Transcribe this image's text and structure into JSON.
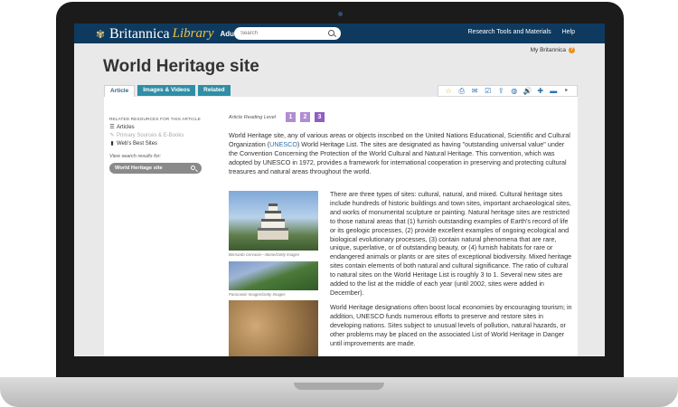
{
  "header": {
    "logo_text": "Britannica",
    "logo_library": "Library",
    "edition": "Adult",
    "search_placeholder": "Search",
    "nav": [
      "Research Tools and Materials",
      "Help"
    ],
    "my_britannica": "My Britannica"
  },
  "article": {
    "title": "World Heritage site",
    "tabs": [
      {
        "label": "Article",
        "active": true
      },
      {
        "label": "Images & Videos",
        "active": false
      },
      {
        "label": "Related",
        "active": false
      }
    ],
    "toolbar_icons": [
      "star-icon",
      "print-icon",
      "email-icon",
      "cite-icon",
      "share-icon",
      "globe-icon",
      "audio-icon",
      "zoom-in-icon",
      "zoom-out-icon",
      "next-icon"
    ],
    "reading_level_label": "Article Reading Level",
    "reading_levels": [
      "1",
      "2",
      "3"
    ],
    "current_level": "3",
    "intro_before": "World Heritage site,  any of various areas or objects inscribed on the United Nations Educational, Scientific and Cultural Organization (",
    "intro_link": "UNESCO",
    "intro_after": ") World Heritage List. The sites are designated as having \"outstanding universal value\" under the Convention Concerning the Protection of the World Cultural and Natural Heritage. This convention, which was adopted by UNESCO in 1972, provides a framework for international cooperation in preserving and protecting cultural treasures and natural areas throughout the world.",
    "paragraph_1": "There are three types of sites: cultural, natural, and mixed. Cultural heritage sites include hundreds of historic buildings and town sites, important archaeological sites, and works of monumental sculpture or painting. Natural heritage sites are restricted to those natural areas that (1) furnish outstanding examples of Earth's record of life or its geologic processes, (2) provide excellent examples of ongoing ecological and biological evolutionary processes, (3) contain natural phenomena that are rare, unique, superlative, or of outstanding beauty, or (4) furnish habitats for rare or endangered animals or plants or are sites of exceptional biodiversity. Mixed heritage sites contain elements of both natural and cultural significance. The ratio of cultural to natural sites on the World Heritage List is roughly 3 to 1. Several new sites are added to the list at the middle of each year (until 2002, sites were added in December).",
    "paragraph_2": "World Heritage designations often boost local economies by encouraging tourism; in addition, UNESCO funds numerous efforts to preserve and restore sites in developing nations. Sites subject to unusual levels of pollution, natural hazards, or other problems may be placed on the associated List of World Heritage in Danger until improvements are made.",
    "caption_1": "Bernardo Cervacio—Stone/Getty Images",
    "caption_2": "Panoramic Images/Getty Images"
  },
  "sidebar": {
    "heading": "RELATED RESOURCES FOR THIS ARTICLE",
    "items": [
      {
        "label": "Articles",
        "icon": "list-icon",
        "muted": false
      },
      {
        "label": "Primary Sources & E-Books",
        "icon": "edit-icon",
        "muted": true
      },
      {
        "label": "Web's Best Sites",
        "icon": "bookmark-icon",
        "muted": false
      }
    ],
    "view_label": "View search results for:",
    "search_pill": "World Heritage site"
  },
  "colors": {
    "nav_bg": "#0f3a5f",
    "tab_bg": "#2f8ea6",
    "level_purple": "#8f5fbf",
    "link_blue": "#2d6fb0",
    "star_orange": "#e8a321"
  }
}
